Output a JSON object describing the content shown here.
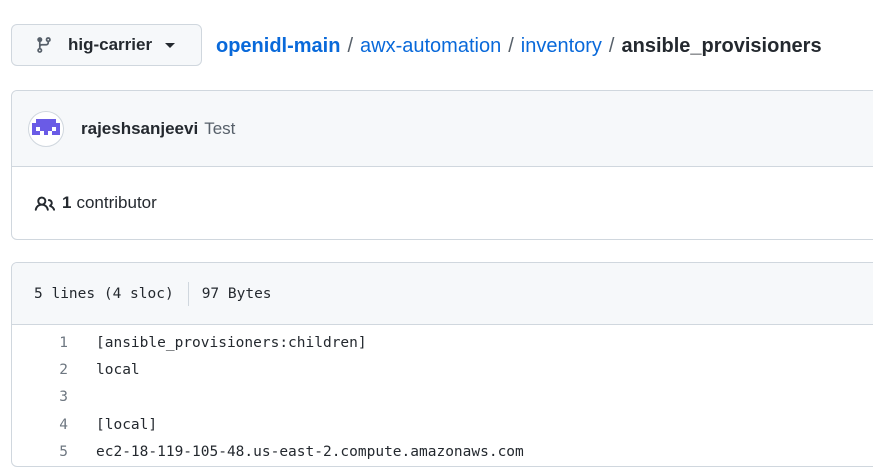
{
  "branch": {
    "name": "hig-carrier",
    "icon": "git-branch-icon"
  },
  "breadcrumb": {
    "repo": "openidl-main",
    "separator": "/",
    "path": [
      "awx-automation",
      "inventory"
    ],
    "current": "ansible_provisioners"
  },
  "commit": {
    "author": "rajeshsanjeevi",
    "message": "Test",
    "avatar_color": "#5c4fe0"
  },
  "contributors": {
    "count": "1",
    "label": "contributor",
    "icon": "people-icon"
  },
  "file": {
    "lines_info": "5 lines (4 sloc)",
    "size": "97 Bytes",
    "lines": [
      {
        "number": "1",
        "text": "[ansible_provisioners:children]"
      },
      {
        "number": "2",
        "text": "local"
      },
      {
        "number": "3",
        "text": ""
      },
      {
        "number": "4",
        "text": "[local]"
      },
      {
        "number": "5",
        "text": "ec2-18-119-105-48.us-east-2.compute.amazonaws.com"
      }
    ]
  },
  "colors": {
    "link": "#0969da",
    "border": "#d0d7de",
    "header_bg": "#f6f8fa",
    "muted": "#57606a"
  }
}
